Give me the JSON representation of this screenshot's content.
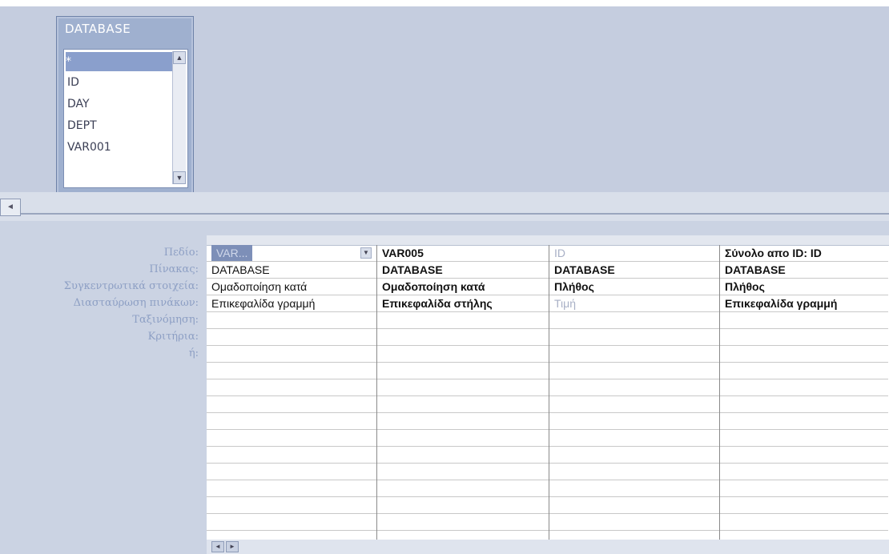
{
  "top_strip_text": "",
  "field_list": {
    "title": "DATABASE",
    "items": [
      "*",
      "ID",
      "DAY",
      "DEPT",
      "VAR001"
    ]
  },
  "row_labels": [
    "Πεδίο:",
    "Πίνακας:",
    "Συγκεντρωτικά στοιχεία:",
    "Διασταύρωση πινάκων:",
    "Ταξινόμηση:",
    "Κριτήρια:",
    "ή:"
  ],
  "columns": [
    {
      "field": "VAR...",
      "table": "DATABASE",
      "total": "Ομαδοποίηση κατά",
      "crosstab": "Επικεφαλίδα γραμμή"
    },
    {
      "field": "VAR005",
      "table": "DATABASE",
      "total": "Ομαδοποίηση κατά",
      "crosstab": "Επικεφαλίδα στήλης"
    },
    {
      "field": "ID",
      "table": "DATABASE",
      "total": "Πλήθος",
      "crosstab": "Τιμή"
    },
    {
      "field": "Σύνολο απο ID: ID",
      "table": "DATABASE",
      "total": "Πλήθος",
      "crosstab": "Επικεφαλίδα γραμμή"
    }
  ]
}
